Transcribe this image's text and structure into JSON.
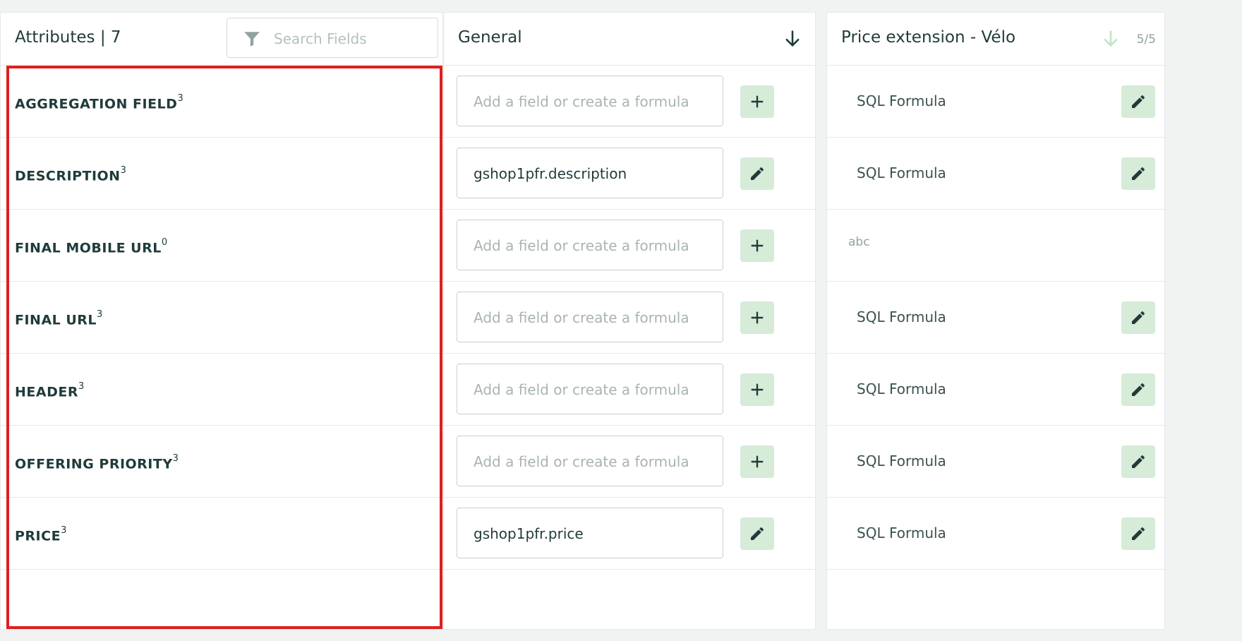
{
  "attributes": {
    "title": "Attributes | 7",
    "search_placeholder": "Search Fields",
    "rows": [
      {
        "label": "AGGREGATION FIELD",
        "sup": "3"
      },
      {
        "label": "DESCRIPTION",
        "sup": "3"
      },
      {
        "label": "FINAL MOBILE URL",
        "sup": "0"
      },
      {
        "label": "FINAL URL",
        "sup": "3"
      },
      {
        "label": "HEADER",
        "sup": "3"
      },
      {
        "label": "OFFERING PRIORITY",
        "sup": "3"
      },
      {
        "label": "PRICE",
        "sup": "3"
      }
    ]
  },
  "general": {
    "title": "General",
    "placeholder": "Add a field or create a formula",
    "rows": [
      {
        "value": "",
        "action": "add"
      },
      {
        "value": "gshop1pfr.description",
        "action": "edit"
      },
      {
        "value": "",
        "action": "add"
      },
      {
        "value": "",
        "action": "add"
      },
      {
        "value": "",
        "action": "add"
      },
      {
        "value": "",
        "action": "add"
      },
      {
        "value": "gshop1pfr.price",
        "action": "edit"
      }
    ]
  },
  "price_extension": {
    "title": "Price extension - Vélo",
    "count": "5/5",
    "rows": [
      {
        "text": "SQL Formula",
        "action": "edit"
      },
      {
        "text": "SQL Formula",
        "action": "edit"
      },
      {
        "text": "abc",
        "action": "none"
      },
      {
        "text": "SQL Formula",
        "action": "edit"
      },
      {
        "text": "SQL Formula",
        "action": "edit"
      },
      {
        "text": "SQL Formula",
        "action": "edit"
      },
      {
        "text": "SQL Formula",
        "action": "edit"
      }
    ]
  },
  "colors": {
    "accent_bg": "#d6ebd8",
    "icon_dark": "#1f3b3a",
    "highlight": "#df1f1f",
    "sort_muted": "#c3e3c7"
  },
  "icons": {
    "filter": "filter-icon",
    "sort": "arrow-down-icon",
    "add": "plus-icon",
    "edit": "pencil-icon"
  }
}
